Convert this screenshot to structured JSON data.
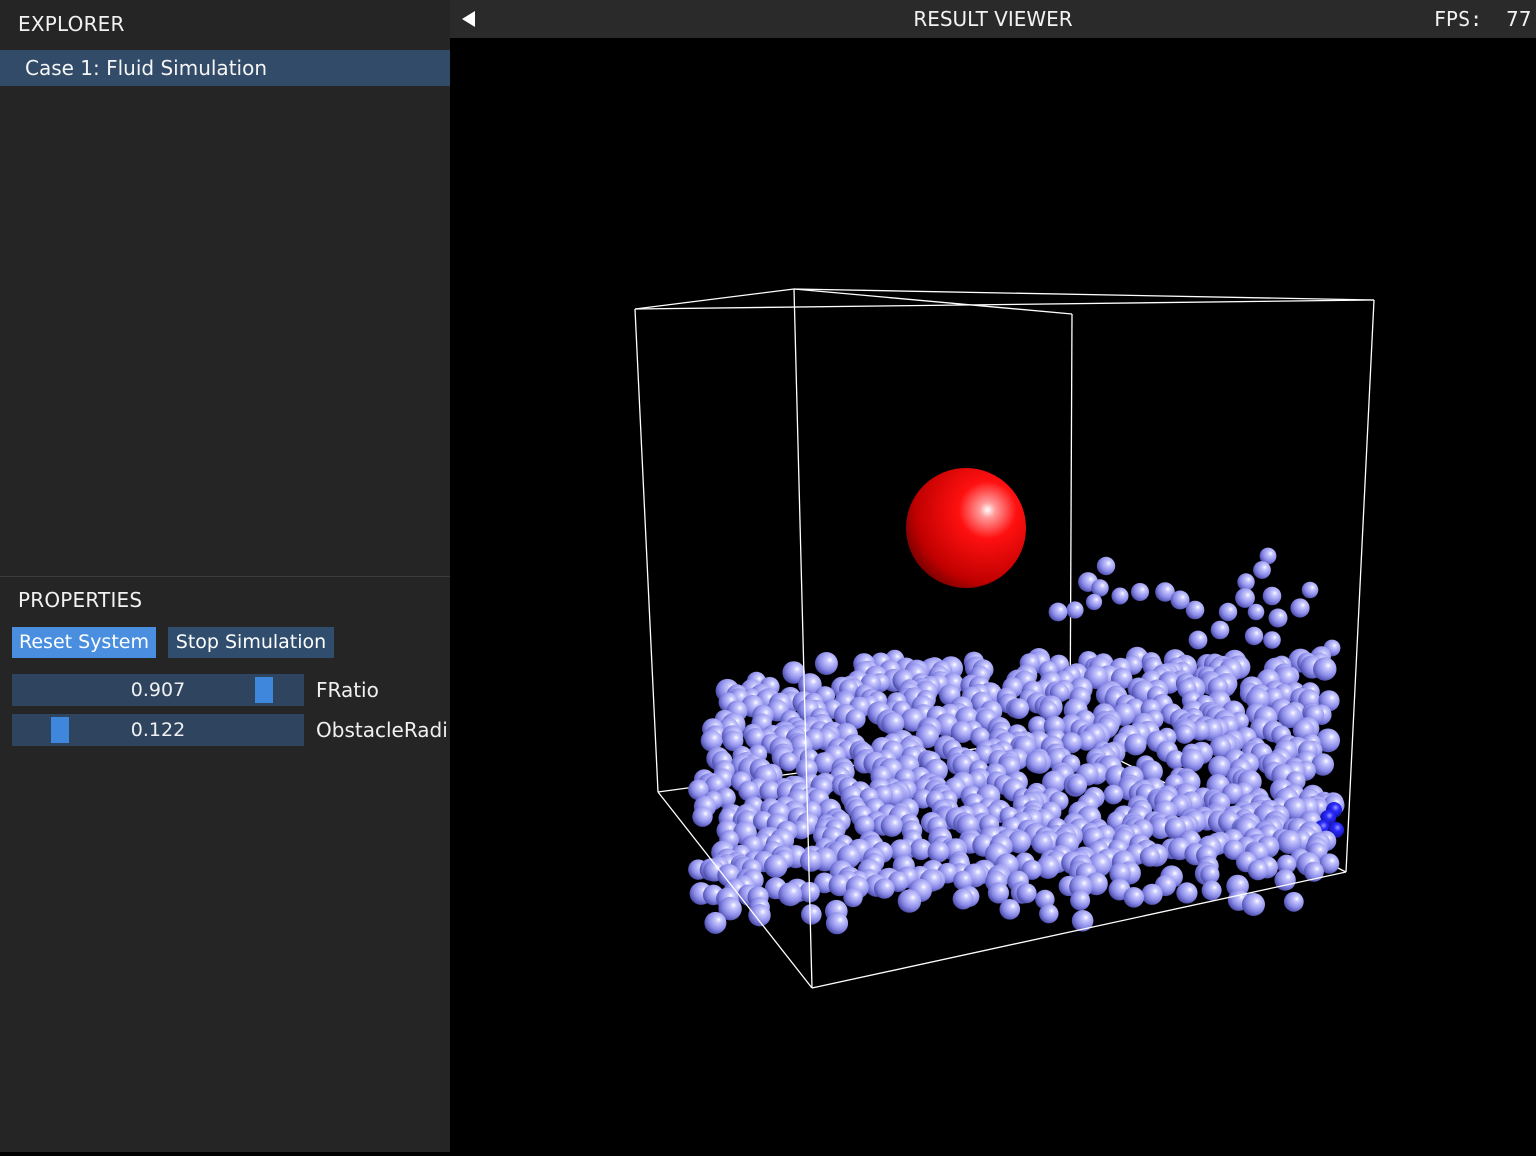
{
  "explorer": {
    "title": "EXPLORER",
    "items": [
      {
        "label": "Case 1: Fluid Simulation",
        "selected": true
      }
    ]
  },
  "properties": {
    "title": "PROPERTIES",
    "buttons": {
      "reset": "Reset System",
      "stop": "Stop Simulation"
    },
    "sliders": [
      {
        "label": "FRatio",
        "value": "0.907",
        "fraction": 0.907
      },
      {
        "label": "ObstacleRadi",
        "value": "0.122",
        "fraction": 0.122
      }
    ]
  },
  "viewer": {
    "title": "RESULT VIEWER",
    "fps_label": "FPS:",
    "fps_value": "77"
  },
  "scene": {
    "obstacle_color": "#ff1a1a",
    "particle_color": "#8c8cf0",
    "highlight_particle_color": "#1a1ae0",
    "box_color": "#ffffff"
  },
  "colors": {
    "panel_bg": "#252525",
    "selection": "#324b68",
    "accent": "#4a8fdf",
    "button_dark": "#304d6d",
    "slider_bg": "#2f455f"
  }
}
